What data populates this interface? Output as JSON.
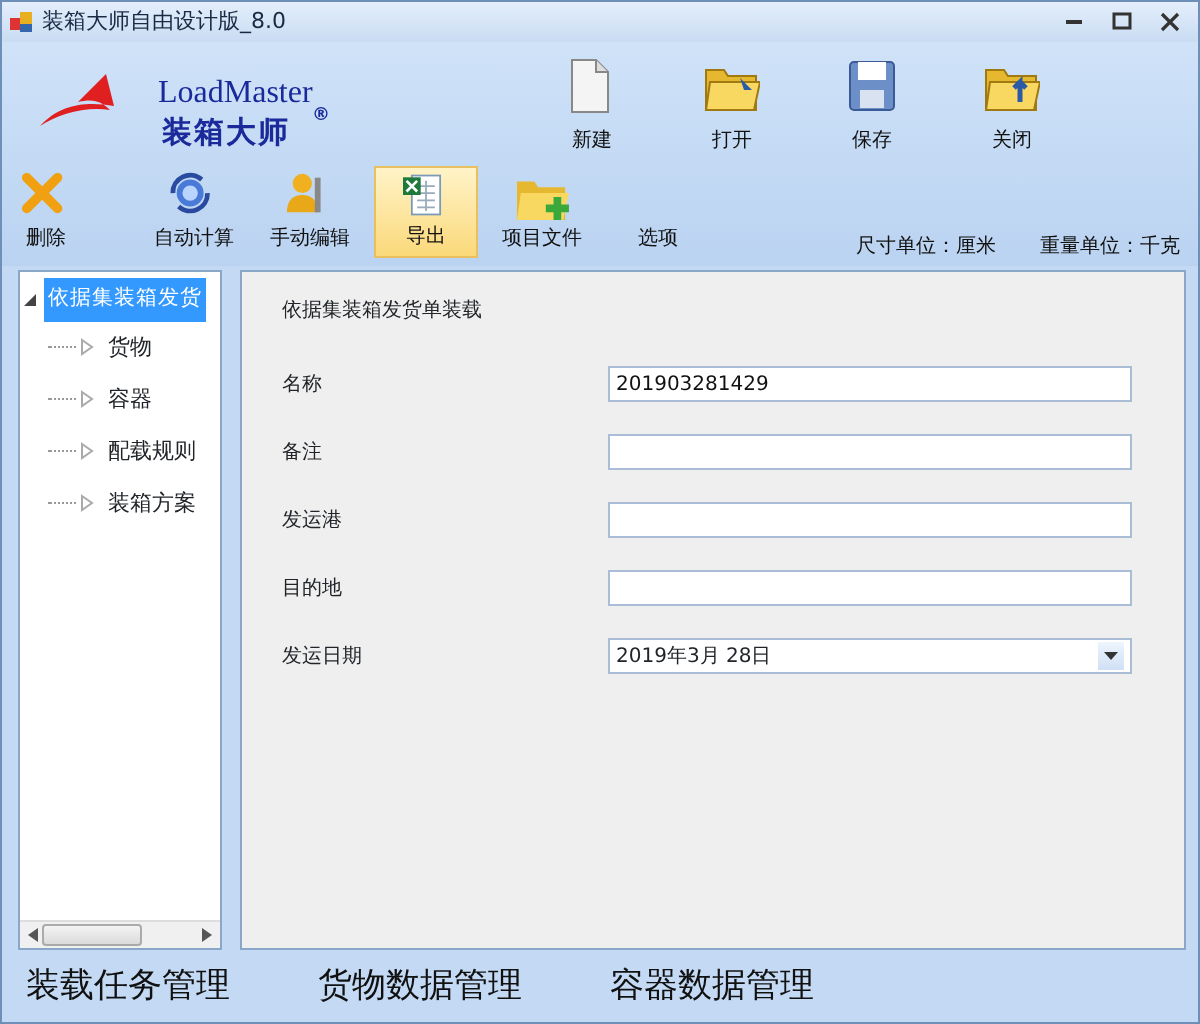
{
  "window": {
    "title": "装箱大师自由设计版_8.0"
  },
  "logo": {
    "name": "LoadMaster",
    "tagline": "装箱大师",
    "mark": "®"
  },
  "file_buttons": [
    {
      "label": "新建",
      "kind": "new"
    },
    {
      "label": "打开",
      "kind": "open"
    },
    {
      "label": "保存",
      "kind": "save"
    },
    {
      "label": "关闭",
      "kind": "close"
    }
  ],
  "toolbar": [
    {
      "label": "删除",
      "kind": "delete",
      "selected": false
    },
    {
      "label": "自动计算",
      "kind": "calc",
      "selected": false
    },
    {
      "label": "手动编辑",
      "kind": "edit",
      "selected": false
    },
    {
      "label": "导出",
      "kind": "export",
      "selected": true
    },
    {
      "label": "项目文件",
      "kind": "project",
      "selected": false
    },
    {
      "label": "选项",
      "kind": "options",
      "selected": false
    }
  ],
  "units": [
    "尺寸单位：厘米",
    "重量单位：千克"
  ],
  "tree": {
    "label": "依据集装箱发货",
    "expanded": true,
    "selected": true,
    "children": [
      {
        "label": "货物",
        "expanded": false
      },
      {
        "label": "容器",
        "expanded": false
      },
      {
        "label": "配载规则",
        "expanded": false
      },
      {
        "label": "装箱方案",
        "expanded": false
      }
    ]
  },
  "form": {
    "heading": "依据集装箱发货单装载",
    "fields": [
      {
        "label": "名称",
        "value": "201903281429",
        "kind": "text"
      },
      {
        "label": "备注",
        "kind": "text"
      },
      {
        "label": "发运港",
        "kind": "text"
      },
      {
        "label": "目的地",
        "kind": "text"
      },
      {
        "label": "发运日期",
        "value": "2019年3月 28日",
        "kind": "date"
      }
    ]
  },
  "bottom_tabs": [
    "装载任务管理",
    "货物数据管理",
    "容器数据管理"
  ]
}
